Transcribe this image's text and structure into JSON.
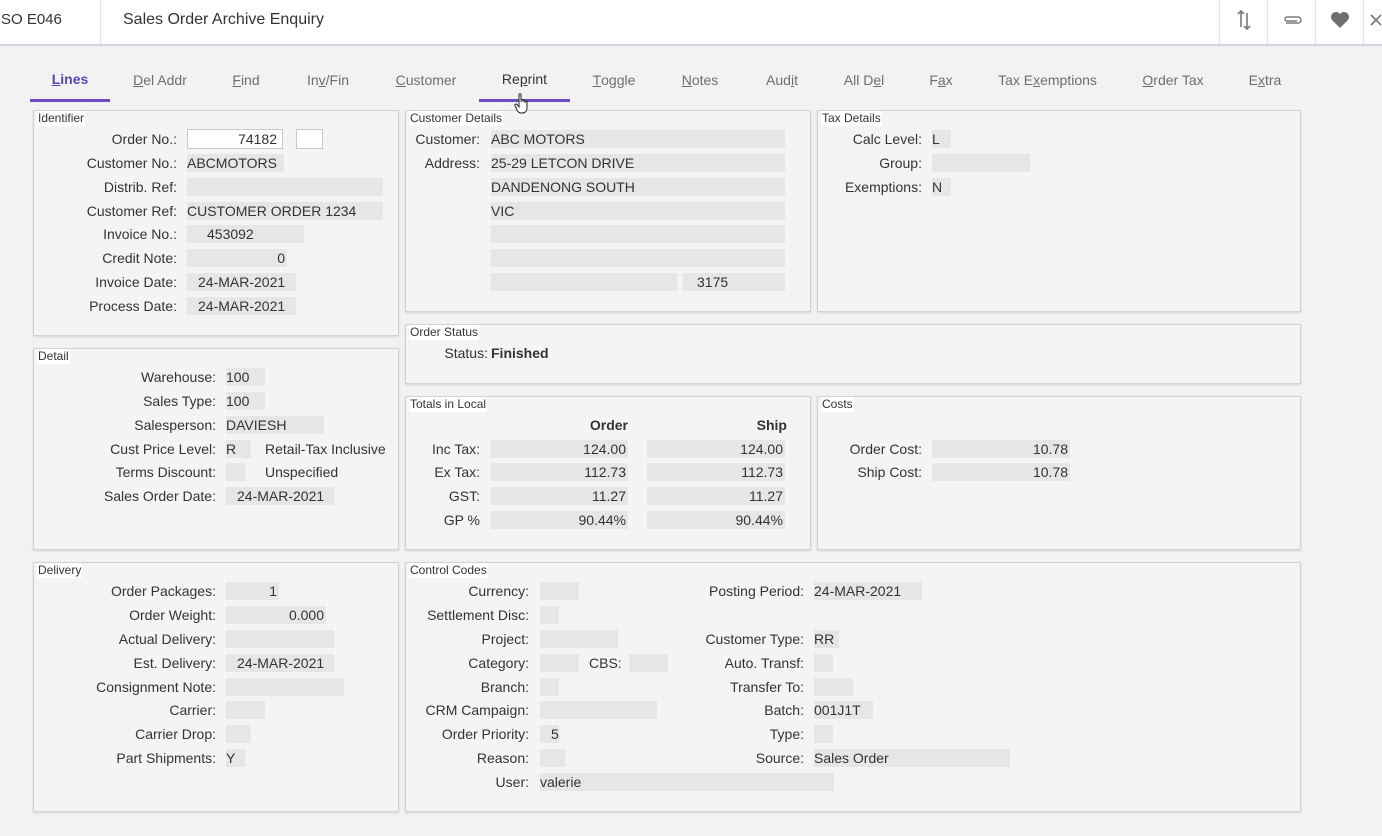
{
  "app": {
    "code": "SO E046",
    "title": "Sales Order Archive Enquiry"
  },
  "toolbar_icons": [
    "sort-arrows-icon",
    "paperclip-icon",
    "heart-icon",
    "close-icon"
  ],
  "tabs": [
    {
      "pre": "",
      "u": "L",
      "post": "ines",
      "state": "active"
    },
    {
      "pre": "",
      "u": "D",
      "post": "el Addr",
      "state": ""
    },
    {
      "pre": "",
      "u": "F",
      "post": "ind",
      "state": ""
    },
    {
      "pre": "In",
      "u": "v",
      "post": "/Fin",
      "state": ""
    },
    {
      "pre": "",
      "u": "C",
      "post": "ustomer",
      "state": ""
    },
    {
      "pre": "Re",
      "u": "p",
      "post": "rint",
      "state": "hover"
    },
    {
      "pre": "",
      "u": "T",
      "post": "oggle",
      "state": ""
    },
    {
      "pre": "",
      "u": "N",
      "post": "otes",
      "state": ""
    },
    {
      "pre": "Aud",
      "u": "i",
      "post": "t",
      "state": ""
    },
    {
      "pre": "All D",
      "u": "e",
      "post": "l",
      "state": ""
    },
    {
      "pre": "F",
      "u": "a",
      "post": "x",
      "state": ""
    },
    {
      "pre": "Tax E",
      "u": "x",
      "post": "emptions",
      "state": ""
    },
    {
      "pre": "",
      "u": "O",
      "post": "rder Tax",
      "state": ""
    },
    {
      "pre": "E",
      "u": "x",
      "post": "tra",
      "state": ""
    }
  ],
  "identifier": {
    "title": "Identifier",
    "order_no_label": "Order No.:",
    "order_no": "74182",
    "order_suffix": "",
    "customer_no_label": "Customer No.:",
    "customer_no": "ABCMOTORS",
    "distrib_ref_label": "Distrib. Ref:",
    "distrib_ref": "",
    "customer_ref_label": "Customer Ref:",
    "customer_ref": "CUSTOMER ORDER 1234",
    "invoice_no_label": "Invoice No.:",
    "invoice_no": "453092",
    "credit_note_label": "Credit Note:",
    "credit_note": "0",
    "invoice_date_label": "Invoice Date:",
    "invoice_date": "24-MAR-2021",
    "process_date_label": "Process Date:",
    "process_date": "24-MAR-2021"
  },
  "customer_details": {
    "title": "Customer Details",
    "customer_label": "Customer:",
    "customer": "ABC MOTORS",
    "address_label": "Address:",
    "address": [
      "25-29 LETCON DRIVE",
      "DANDENONG SOUTH",
      "VIC",
      "",
      ""
    ],
    "postcode": "3175"
  },
  "tax_details": {
    "title": "Tax Details",
    "calc_level_label": "Calc Level:",
    "calc_level": "L",
    "group_label": "Group:",
    "group": "",
    "exemptions_label": "Exemptions:",
    "exemptions": "N"
  },
  "order_status": {
    "title": "Order Status",
    "status_label": "Status:",
    "status": "Finished"
  },
  "detail": {
    "title": "Detail",
    "warehouse_label": "Warehouse:",
    "warehouse": "100",
    "sales_type_label": "Sales Type:",
    "sales_type": "100",
    "salesperson_label": "Salesperson:",
    "salesperson": "DAVIESH",
    "cust_price_level_label": "Cust Price Level:",
    "cust_price_level": "R",
    "cust_price_level_desc": "Retail-Tax Inclusive",
    "terms_discount_label": "Terms Discount:",
    "terms_discount": "",
    "terms_discount_desc": "Unspecified",
    "sales_order_date_label": "Sales Order Date:",
    "sales_order_date": "24-MAR-2021"
  },
  "totals": {
    "title": "Totals in Local",
    "order_header": "Order",
    "ship_header": "Ship",
    "rows": [
      {
        "label": "Inc Tax:",
        "order": "124.00",
        "ship": "124.00"
      },
      {
        "label": "Ex Tax:",
        "order": "112.73",
        "ship": "112.73"
      },
      {
        "label": "GST:",
        "order": "11.27",
        "ship": "11.27"
      },
      {
        "label": "GP %",
        "order": "90.44%",
        "ship": "90.44%"
      }
    ]
  },
  "costs": {
    "title": "Costs",
    "order_cost_label": "Order Cost:",
    "order_cost": "10.78",
    "ship_cost_label": "Ship Cost:",
    "ship_cost": "10.78"
  },
  "delivery": {
    "title": "Delivery",
    "order_packages_label": "Order Packages:",
    "order_packages": "1",
    "order_weight_label": "Order Weight:",
    "order_weight": "0.000",
    "actual_delivery_label": "Actual Delivery:",
    "actual_delivery": "",
    "est_delivery_label": "Est. Delivery:",
    "est_delivery": "24-MAR-2021",
    "consignment_note_label": "Consignment Note:",
    "consignment_note": "",
    "carrier_label": "Carrier:",
    "carrier": "",
    "carrier_drop_label": "Carrier Drop:",
    "carrier_drop": "",
    "part_shipments_label": "Part Shipments:",
    "part_shipments": "Y"
  },
  "control_codes": {
    "title": "Control Codes",
    "currency_label": "Currency:",
    "currency": "",
    "settlement_disc_label": "Settlement Disc:",
    "settlement_disc": "",
    "project_label": "Project:",
    "project": "",
    "category_label": "Category:",
    "category": "",
    "cbs_label": "CBS:",
    "cbs": "",
    "branch_label": "Branch:",
    "branch": "",
    "crm_campaign_label": "CRM Campaign:",
    "crm_campaign": "",
    "order_priority_label": "Order Priority:",
    "order_priority": "5",
    "reason_label": "Reason:",
    "reason": "",
    "user_label": "User:",
    "user": "valerie",
    "posting_period_label": "Posting Period:",
    "posting_period": "24-MAR-2021",
    "customer_type_label": "Customer Type:",
    "customer_type": "RR",
    "auto_transf_label": "Auto. Transf:",
    "auto_transf": "",
    "transfer_to_label": "Transfer To:",
    "transfer_to": "",
    "batch_label": "Batch:",
    "batch": "001J1T",
    "type_label": "Type:",
    "type": "",
    "source_label": "Source:",
    "source": "Sales Order"
  }
}
